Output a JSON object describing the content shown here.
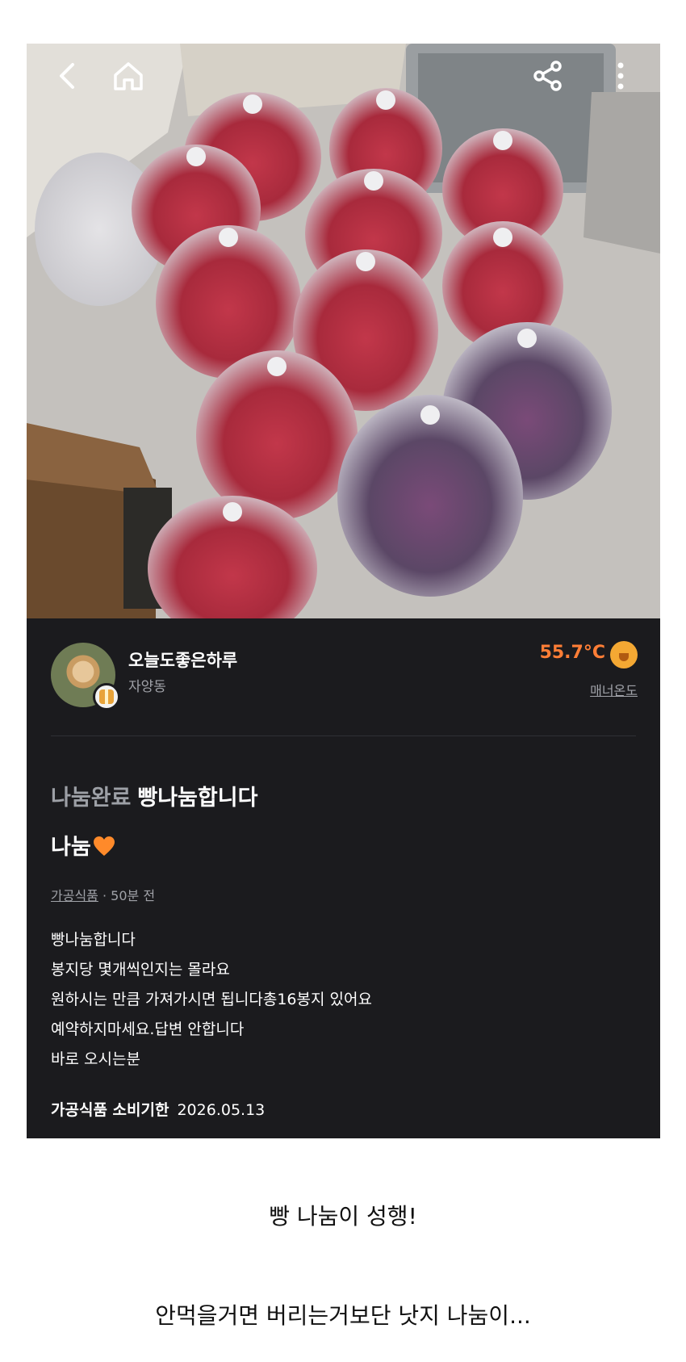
{
  "nav": {
    "back_icon": "chevron-left-icon",
    "home_icon": "home-icon",
    "share_icon": "share-icon",
    "more_icon": "more-vertical-icon"
  },
  "seller": {
    "nickname": "오늘도좋은하루",
    "location": "자양동",
    "temperature": "55.7°C",
    "temperature_label": "매너온도"
  },
  "post": {
    "status": "나눔완료",
    "title": "빵나눔합니다",
    "subtitle": "나눔",
    "category": "가공식품",
    "time_separator": "·",
    "time_ago": "50분 전",
    "body": [
      "빵나눔합니다",
      "봉지당 몇개씩인지는 몰라요",
      "원하시는 만큼 가져가시면 됩니다총16봉지 있어요",
      "예약하지마세요.답변 안합니다",
      "바로 오시는분"
    ],
    "expiry_label": "가공식품 소비기한",
    "expiry_date": "2026.05.13"
  },
  "captions": {
    "line1": "빵 나눔이 성행!",
    "line2": "안먹을거면 버리는거보단 낫지 나눔이..."
  },
  "colors": {
    "background_dark": "#1b1b1e",
    "accent_orange": "#ff7e36",
    "muted_text": "#a0a2a8"
  }
}
